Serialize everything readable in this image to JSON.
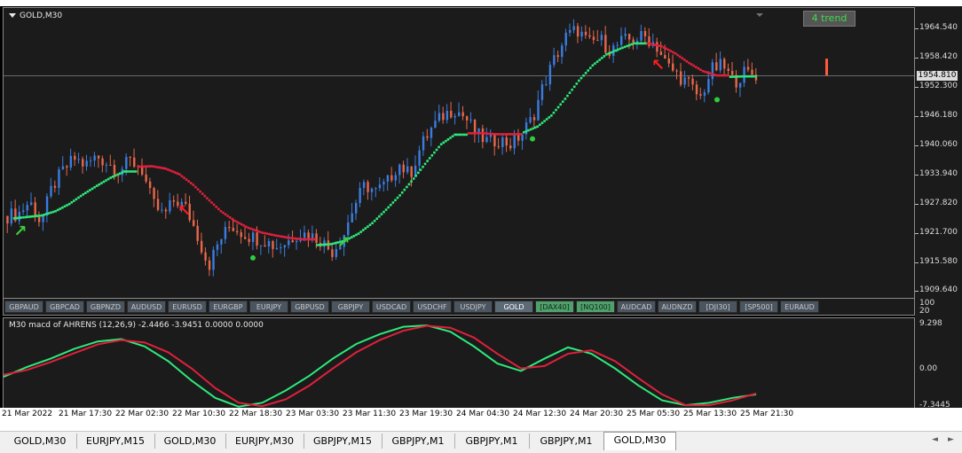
{
  "chart": {
    "title": "GOLD,M30",
    "trend_badge": "4 trend",
    "current_price": "1954.810",
    "price_ticks": [
      "1964.540",
      "1958.420",
      "1952.300",
      "1946.180",
      "1940.060",
      "1933.940",
      "1927.820",
      "1921.700",
      "1915.580",
      "1909.640"
    ],
    "price_range": [
      1909.64,
      1964.54
    ],
    "colors": {
      "bull_candle": "#3a7de0",
      "bear_candle": "#e8674a",
      "trail_up": "#2ee87a",
      "trail_down": "#e0203c",
      "arrow_up": "#3ccf3c",
      "arrow_down": "#ff1e1e",
      "macd_line": "#2ee87a",
      "signal_line": "#e0203c"
    }
  },
  "symbols": [
    {
      "label": "GBPAUD",
      "state": "normal"
    },
    {
      "label": "GBPCAD",
      "state": "normal"
    },
    {
      "label": "GBPNZD",
      "state": "normal"
    },
    {
      "label": "AUDUSD",
      "state": "normal"
    },
    {
      "label": "EURUSD",
      "state": "normal"
    },
    {
      "label": "EURGBP",
      "state": "normal"
    },
    {
      "label": "EURJPY",
      "state": "normal"
    },
    {
      "label": "GBPUSD",
      "state": "normal"
    },
    {
      "label": "GBPJPY",
      "state": "normal"
    },
    {
      "label": "USDCAD",
      "state": "normal"
    },
    {
      "label": "USDCHF",
      "state": "normal"
    },
    {
      "label": "USDJPY",
      "state": "normal"
    },
    {
      "label": "GOLD",
      "state": "active"
    },
    {
      "label": "[DAX40]",
      "state": "green"
    },
    {
      "label": "[NQ100]",
      "state": "green"
    },
    {
      "label": "AUDCAD",
      "state": "normal"
    },
    {
      "label": "AUDNZD",
      "state": "normal"
    },
    {
      "label": "[DJI30]",
      "state": "normal"
    },
    {
      "label": "[SP500]",
      "state": "normal"
    },
    {
      "label": "EURAUD",
      "state": "normal"
    }
  ],
  "separator_ticks": [
    "100",
    "20"
  ],
  "macd": {
    "label": "M30 macd of AHRENS (12,26,9) -2.4466 -3.9451 0.0000 0.0000",
    "ticks": [
      "9.298",
      "0.00",
      "-7.3445"
    ],
    "range": [
      -7.3445,
      9.298
    ]
  },
  "time_labels": [
    "21 Mar 2022",
    "21 Mar 17:30",
    "22 Mar 02:30",
    "22 Mar 10:30",
    "22 Mar 18:30",
    "23 Mar 03:30",
    "23 Mar 11:30",
    "23 Mar 19:30",
    "24 Mar 04:30",
    "24 Mar 12:30",
    "24 Mar 20:30",
    "25 Mar 05:30",
    "25 Mar 13:30",
    "25 Mar 21:30"
  ],
  "tabs": [
    {
      "label": "GOLD,M30",
      "active": false
    },
    {
      "label": "EURJPY,M15",
      "active": false
    },
    {
      "label": "GOLD,M30",
      "active": false
    },
    {
      "label": "EURJPY,M30",
      "active": false
    },
    {
      "label": "GBPJPY,M15",
      "active": false
    },
    {
      "label": "GBPJPY,M1",
      "active": false
    },
    {
      "label": "GBPJPY,M1",
      "active": false
    },
    {
      "label": "GBPJPY,M1",
      "active": false
    },
    {
      "label": "GOLD,M30",
      "active": true
    }
  ],
  "chart_data": {
    "type": "line",
    "price_path": [
      1925.5,
      1926.0,
      1928.5,
      1924.0,
      1931.5,
      1935.0,
      1937.5,
      1936.0,
      1938.0,
      1936.5,
      1935.0,
      1937.0,
      1935.5,
      1928.0,
      1925.5,
      1929.0,
      1927.0,
      1921.5,
      1915.0,
      1920.5,
      1923.5,
      1922.0,
      1921.0,
      1920.5,
      1919.0,
      1920.0,
      1922.0,
      1921.5,
      1920.5,
      1918.0,
      1921.0,
      1927.5,
      1932.0,
      1930.5,
      1932.5,
      1936.5,
      1934.0,
      1940.0,
      1944.0,
      1946.5,
      1948.0,
      1946.0,
      1942.5,
      1941.0,
      1941.5,
      1940.5,
      1942.5,
      1946.0,
      1953.0,
      1958.5,
      1963.0,
      1964.5,
      1961.5,
      1962.5,
      1960.0,
      1962.0,
      1962.5,
      1963.0,
      1961.5,
      1957.0,
      1955.0,
      1953.0,
      1950.0,
      1956.0,
      1957.0,
      1953.5,
      1955.5,
      1955.0
    ],
    "trail_segments": [
      {
        "dir": "up",
        "values": [
          1925.0,
          1925.3,
          1925.6,
          1926.5,
          1928.0,
          1930.0,
          1931.8,
          1933.5,
          1934.8
        ]
      },
      {
        "dir": "down",
        "values": [
          1935.8,
          1935.9,
          1935.4,
          1934.2,
          1932.0,
          1929.2,
          1926.5,
          1924.5,
          1923.0,
          1922.0,
          1921.4,
          1920.9,
          1920.6
        ]
      },
      {
        "dir": "up",
        "values": [
          1919.4,
          1919.6,
          1920.3,
          1921.8,
          1924.0,
          1926.8,
          1929.8,
          1933.3,
          1937.0,
          1940.5,
          1942.5
        ]
      },
      {
        "dir": "down",
        "values": [
          1942.8,
          1942.8,
          1942.6,
          1942.6
        ]
      },
      {
        "dir": "up",
        "values": [
          1943.0,
          1944.2,
          1946.5,
          1950.0,
          1953.8,
          1957.0,
          1959.3,
          1960.5,
          1961.6
        ]
      },
      {
        "dir": "down",
        "values": [
          1961.6,
          1961.0,
          1959.5,
          1957.5,
          1955.8,
          1954.9
        ]
      },
      {
        "dir": "up",
        "values": [
          1954.6,
          1954.7
        ]
      }
    ],
    "signals": [
      {
        "type": "buy",
        "label": "↑"
      },
      {
        "type": "sell",
        "label": "↓"
      },
      {
        "type": "buy",
        "label": "↑"
      },
      {
        "type": "sell",
        "label": "↓"
      }
    ],
    "macd_series": [
      {
        "values": [
          -1.2,
          0.8,
          2.5,
          4.5,
          6.0,
          6.5,
          5.0,
          2.0,
          -2.0,
          -5.5,
          -7.3,
          -6.5,
          -4.0,
          -1.0,
          2.5,
          5.5,
          7.5,
          9.0,
          9.3,
          8.0,
          5.0,
          1.5,
          0.0,
          2.5,
          4.8,
          3.5,
          0.5,
          -3.0,
          -6.0,
          -7.0,
          -6.5,
          -5.5,
          -4.8
        ]
      },
      {
        "values": [
          -0.8,
          0.2,
          1.8,
          3.6,
          5.4,
          6.3,
          5.8,
          3.8,
          0.5,
          -3.5,
          -6.5,
          -7.2,
          -5.8,
          -3.0,
          0.5,
          3.8,
          6.3,
          8.2,
          9.2,
          8.8,
          6.8,
          3.5,
          0.5,
          1.0,
          3.5,
          4.2,
          2.0,
          -1.5,
          -4.8,
          -7.0,
          -7.0,
          -6.0,
          -4.6
        ]
      }
    ]
  }
}
